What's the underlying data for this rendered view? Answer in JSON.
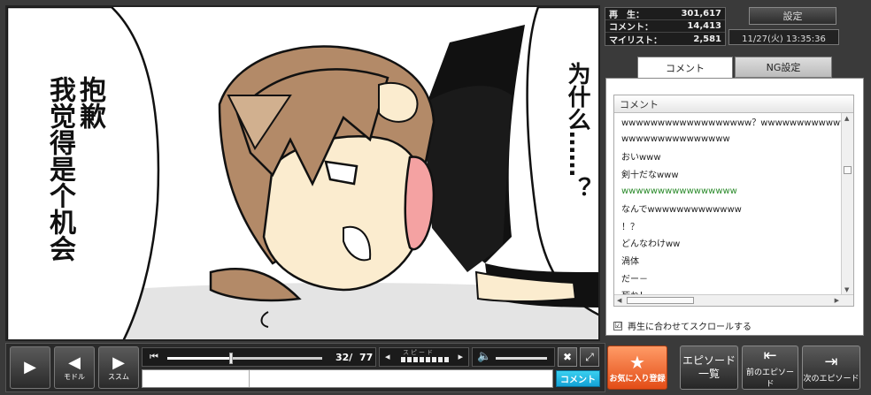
{
  "stats": {
    "views_label": "再　生：",
    "views_value": "301,617",
    "comments_label": "コメント：",
    "comments_value": "14,413",
    "mylist_label": "マイリスト：",
    "mylist_value": "2,581"
  },
  "settings_label": "設定",
  "datetime": "11/27(火) 13:35:36",
  "tabs": {
    "comment": "コメント",
    "ng": "NG設定"
  },
  "comment_list": {
    "header": "コメント",
    "items": [
      "wwwwwwwwwwwwwwwwww？wwwwwwwwwwwwwwwwwwwwww",
      "wwwwwwwwwwwwwww",
      "おいwww",
      "剣十だなwww",
      "wwwwwwwwwwwwwwww",
      "なんでwwwwwwwwwwwww",
      "！？",
      "どんなわけww",
      "渦体",
      "だー－",
      "死ね！"
    ],
    "sync_label": "再生に合わせてスクロールする",
    "sync_checked": "☑"
  },
  "video": {
    "subtitle_left": "抱歉\n我觉得是个机会",
    "subtitle_left_col1": "抱歉",
    "subtitle_left_col2": "我觉得是个机会",
    "subtitle_right": "为什么……？"
  },
  "controls": {
    "play_label": "",
    "back_label": "モドル",
    "fwd_label": "ススム",
    "page_current": "32/",
    "page_total": "77",
    "speed_label": "スピード",
    "progress_fraction": 0.41,
    "comment_placeholder": "",
    "comment_submit": "コメント"
  },
  "buttons": {
    "favorite": "お気に入り登録",
    "episode_list": "エピソード一覧",
    "prev_episode": "前のエピソード",
    "next_episode": "次のエピソード"
  },
  "icons": {
    "play": "play-icon",
    "back": "back-icon",
    "forward": "forward-icon",
    "star": "star-icon",
    "volume": "volume-icon"
  },
  "colors": {
    "submit_button": "#1aa9da",
    "favorite_button": "#e8561d",
    "hair": "#b38a68",
    "skin": "#fbeccf",
    "tongue": "#f4a2a2"
  }
}
